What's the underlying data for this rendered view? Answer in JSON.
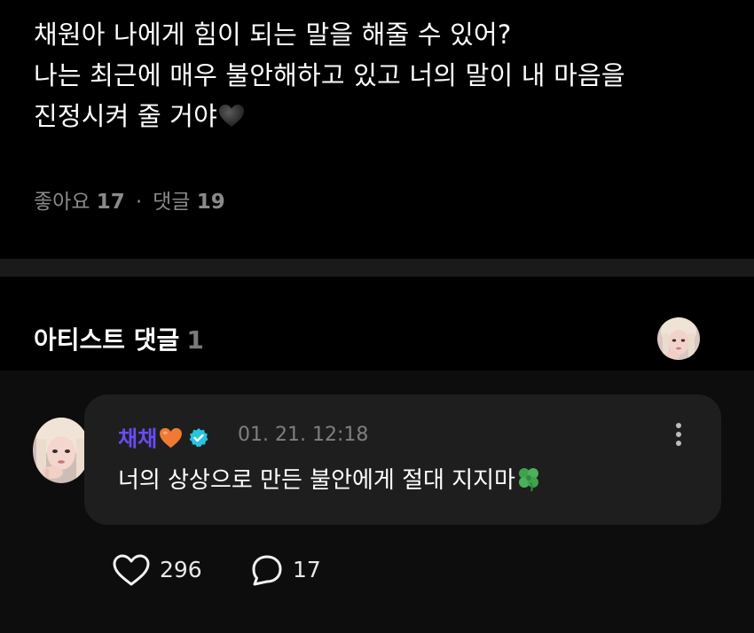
{
  "post": {
    "lines": [
      "채원아 나에게 힘이 되는 말을 해줄 수 있어?",
      "나는 최근에 매우 불안해하고 있고 너의 말이 내 마음을",
      "진정시켜 줄 거야"
    ],
    "likes_label": "좋아요",
    "likes_count": "17",
    "separator": "·",
    "comments_label": "댓글",
    "comments_count": "19"
  },
  "artist_section": {
    "title": "아티스트 댓글",
    "count": "1"
  },
  "comment": {
    "author": "채채",
    "timestamp": "01. 21. 12:18",
    "text": "너의 상상으로 만든 불안에게 절대 지지마",
    "likes": "296",
    "replies": "17"
  },
  "icons": {
    "black_heart": "black-heart-emoji",
    "orange_heart": "orange-heart-emoji",
    "verified": "verified-badge-icon",
    "clover": "four-leaf-clover-emoji",
    "more": "more-vertical-icon",
    "like": "heart-outline-icon",
    "reply": "speech-bubble-icon"
  },
  "colors": {
    "background": "#000000",
    "divider": "#1a1a1a",
    "comment_area": "#0d0d0d",
    "bubble": "#1e1e1e",
    "author": "#6a4cf5",
    "verified": "#27c6e0",
    "orange_heart": "#f07a35",
    "meta_text": "#8a8a8a"
  }
}
